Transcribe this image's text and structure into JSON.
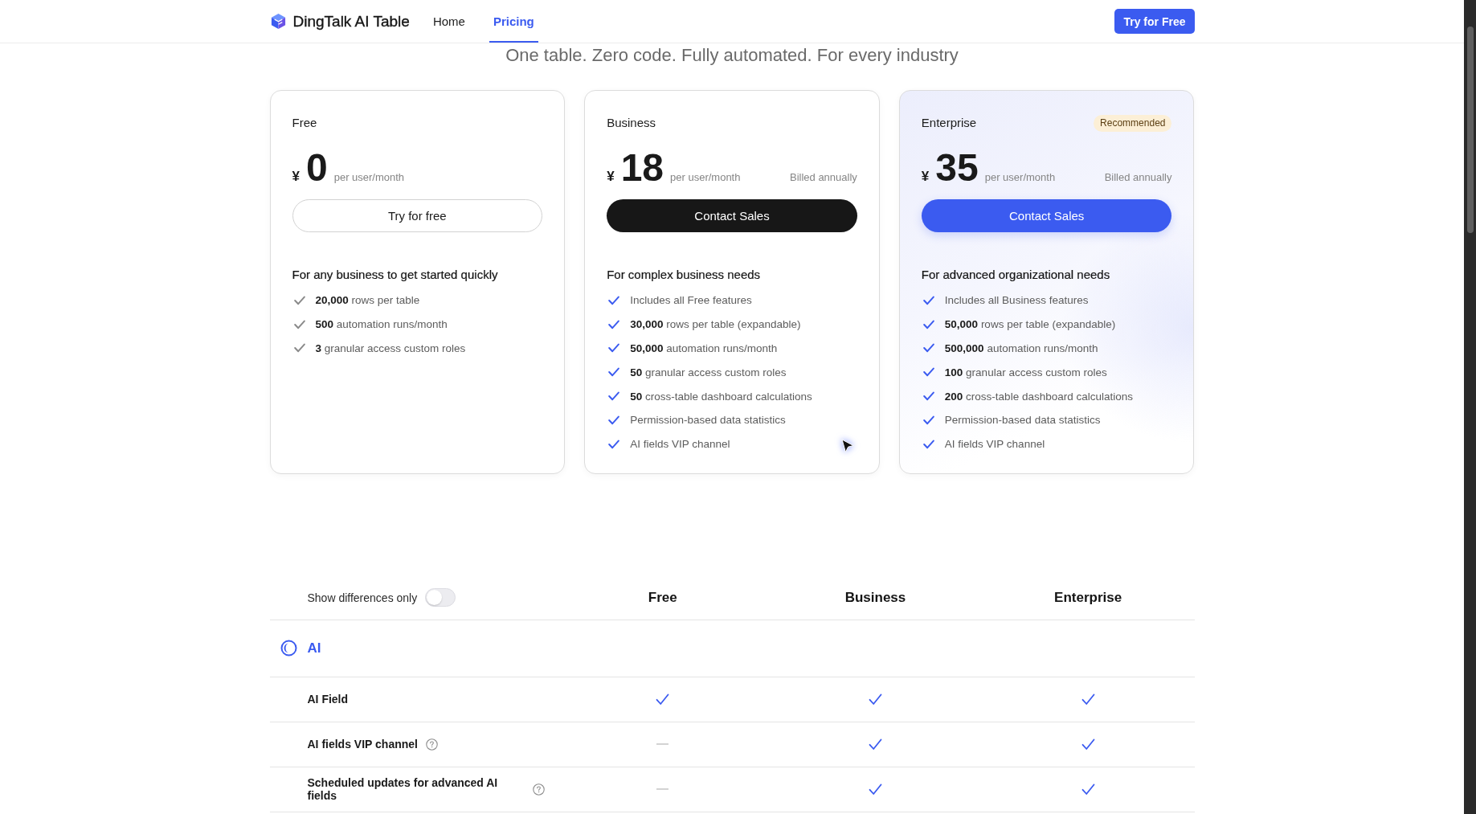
{
  "header": {
    "logo": "DingTalk AI Table",
    "nav": [
      {
        "label": "Home",
        "selected": false
      },
      {
        "label": "Pricing",
        "selected": true
      }
    ],
    "cta": "Try for Free"
  },
  "hero": {
    "subtitle": "One table. Zero code. Fully automated. For every industry"
  },
  "plans": [
    {
      "name": "Free",
      "color": "#8a8a8a",
      "highlighted": false,
      "currency": "¥",
      "amount": "0",
      "unit": "per user/month",
      "button": {
        "label": "Try for free",
        "kind": "outline"
      },
      "description": "For any business to get started quickly",
      "features": [
        "**20,000** rows per table",
        "**500** automation runs/month",
        "**3** granular access custom roles"
      ]
    },
    {
      "name": "Business",
      "color": "#3b5bf0",
      "highlighted": false,
      "currency": "¥",
      "amount": "18",
      "unit": "per user/month",
      "billing": "Billed annually",
      "button": {
        "label": "Contact Sales",
        "kind": "dark"
      },
      "description": "For complex business needs",
      "features": [
        "Includes all Free features",
        "**30,000** rows per table (expandable)",
        "**50,000** automation runs/month",
        "**50** granular access custom roles",
        "**50** cross-table dashboard calculations",
        "Permission-based data statistics",
        "AI fields VIP channel"
      ]
    },
    {
      "name": "Enterprise",
      "badge": "Recommended",
      "color": "#3b5bf0",
      "highlighted": true,
      "currency": "¥",
      "amount": "35",
      "unit": "per user/month",
      "billing": "Billed annually",
      "button": {
        "label": "Contact Sales",
        "kind": "primary"
      },
      "description": "For advanced organizational needs",
      "features": [
        "Includes all Business features",
        "**50,000** rows per table (expandable)",
        "**500,000** automation runs/month",
        "**100** granular access custom roles",
        "**200** cross-table dashboard calculations",
        "Permission-based data statistics",
        "AI fields VIP channel"
      ]
    }
  ],
  "comparison": {
    "toggle": {
      "label": "Show differences only",
      "on": false
    },
    "columns": [
      "Free",
      "Business",
      "Enterprise"
    ],
    "sections": [
      {
        "title": "AI",
        "rows": [
          {
            "feature": "AI Field",
            "help": false,
            "cells": [
              {
                "kind": "check"
              },
              {
                "kind": "check"
              },
              {
                "kind": "check"
              }
            ]
          },
          {
            "feature": "AI fields VIP channel",
            "help": true,
            "cells": [
              {
                "kind": "dash"
              },
              {
                "kind": "check"
              },
              {
                "kind": "check"
              }
            ]
          },
          {
            "feature": "Scheduled updates for advanced AI fields",
            "help": true,
            "cells": [
              {
                "kind": "dash"
              },
              {
                "kind": "check"
              },
              {
                "kind": "check"
              }
            ]
          }
        ]
      }
    ]
  }
}
